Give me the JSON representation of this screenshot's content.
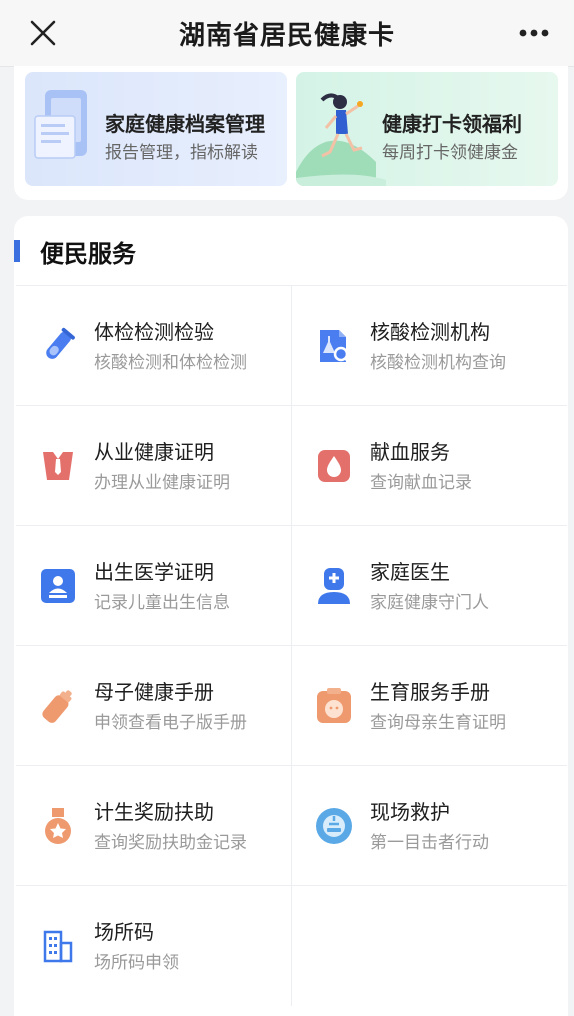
{
  "header": {
    "title": "湖南省居民健康卡",
    "close_icon": "close-icon",
    "more_icon": "more-dots-icon"
  },
  "banners": [
    {
      "title": "家庭健康档案管理",
      "subtitle": "报告管理，指标解读",
      "icon": "health-record-icon",
      "color": "#dbe6fb"
    },
    {
      "title": "健康打卡领福利",
      "subtitle": "每周打卡领健康金",
      "icon": "runner-illustration",
      "color": "#d4f3e6"
    }
  ],
  "services": {
    "title": "便民服务",
    "accent": "#3a6fe0",
    "items": [
      {
        "name": "体检检测检验",
        "desc": "核酸检测和体检检测",
        "icon": "test-tube-icon",
        "color": "#4a7ef0"
      },
      {
        "name": "核酸检测机构",
        "desc": "核酸检测机构查询",
        "icon": "lab-search-icon",
        "color": "#4a7ef0"
      },
      {
        "name": "从业健康证明",
        "desc": "办理从业健康证明",
        "icon": "work-certificate-icon",
        "color": "#e4706c"
      },
      {
        "name": "献血服务",
        "desc": "查询献血记录",
        "icon": "blood-drop-icon",
        "color": "#e4706c"
      },
      {
        "name": "出生医学证明",
        "desc": "记录儿童出生信息",
        "icon": "birth-certificate-icon",
        "color": "#3f78ea"
      },
      {
        "name": "家庭医生",
        "desc": "家庭健康守门人",
        "icon": "doctor-icon",
        "color": "#3f78ea"
      },
      {
        "name": "母子健康手册",
        "desc": "申领查看电子版手册",
        "icon": "baby-bottle-icon",
        "color": "#ef9a6e"
      },
      {
        "name": "生育服务手册",
        "desc": "查询母亲生育证明",
        "icon": "baby-clipboard-icon",
        "color": "#ef9a6e"
      },
      {
        "name": "计生奖励扶助",
        "desc": "查询奖励扶助金记录",
        "icon": "medal-icon",
        "color": "#ef9a6e"
      },
      {
        "name": "现场救护",
        "desc": "第一目击者行动",
        "icon": "sos-icon",
        "color": "#5aa9e6"
      },
      {
        "name": "场所码",
        "desc": "场所码申领",
        "icon": "building-icon",
        "color": "#3f78ea"
      }
    ]
  }
}
